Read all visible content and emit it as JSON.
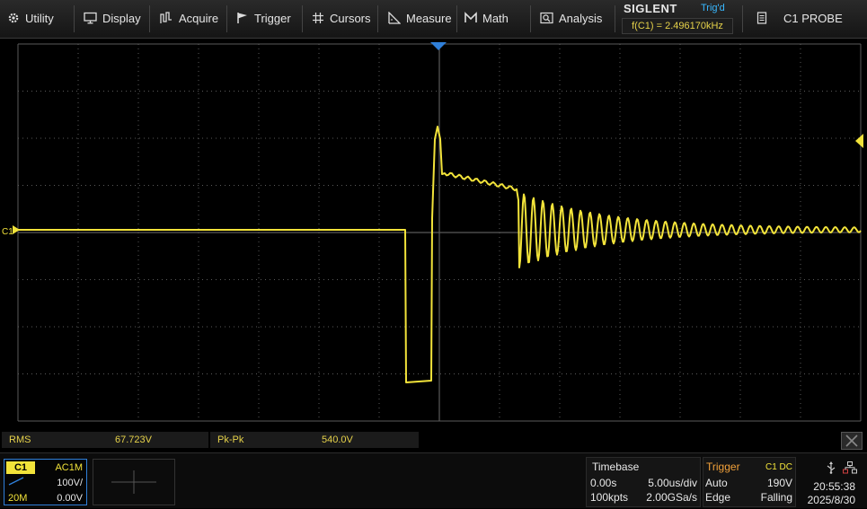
{
  "menu": {
    "utility": "Utility",
    "display": "Display",
    "acquire": "Acquire",
    "trigger": "Trigger",
    "cursors": "Cursors",
    "measure": "Measure",
    "math": "Math",
    "analysis": "Analysis",
    "probe": "C1 PROBE"
  },
  "brand": {
    "name": "SIGLENT",
    "trigger_state": "Trig'd",
    "frequency": "f(C1) = 2.496170kHz"
  },
  "screen": {
    "channel_marker": "C1"
  },
  "measurements": [
    {
      "name": "RMS",
      "value": "67.723V"
    },
    {
      "name": "Pk-Pk",
      "value": "540.0V"
    }
  ],
  "channel1": {
    "label": "C1",
    "coupling": "AC1M",
    "scale": "100V/",
    "bandwidth": "20M",
    "offset": "0.00V"
  },
  "timebase": {
    "title": "Timebase",
    "delay": "0.00s",
    "scale": "5.00us/div",
    "memory": "100kpts",
    "sample_rate": "2.00GSa/s"
  },
  "trigger": {
    "title": "Trigger",
    "source": "C1 DC",
    "mode": "Auto",
    "level": "190V",
    "type": "Edge",
    "slope": "Falling"
  },
  "clock": {
    "time": "20:55:38",
    "date": "2025/8/30"
  },
  "colors": {
    "trace": "#f2e33a",
    "grid": "#5a5a5a",
    "accent_blue": "#2f7fd9"
  }
}
